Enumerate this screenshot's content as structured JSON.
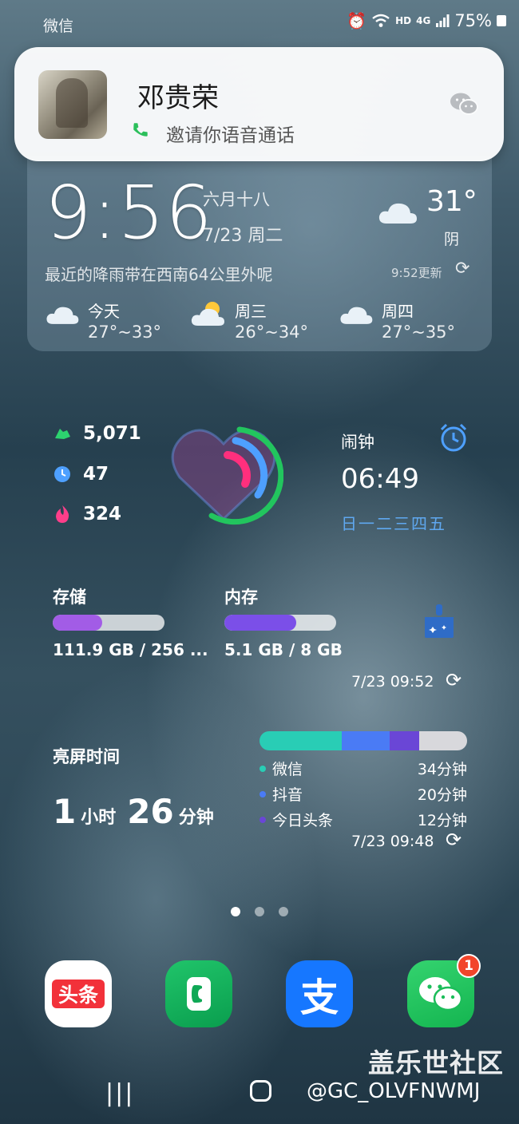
{
  "status_bar": {
    "app_name": "微信",
    "network": "HD",
    "network_gen": "4G",
    "battery": "75%"
  },
  "notification": {
    "caller": "邓贵荣",
    "message": "邀请你语音通话",
    "app_icon": "wechat-icon"
  },
  "clock_widget": {
    "time": "9:56",
    "lunar_date": "六月十八",
    "date": "7/23 周二",
    "current_temp": "31°",
    "condition": "阴",
    "rain_message": "最近的降雨带在西南64公里外呢",
    "updated": "9:52更新",
    "forecast": [
      {
        "day": "今天",
        "range": "27°~33°",
        "icon": "cloud-icon"
      },
      {
        "day": "周三",
        "range": "26°~34°",
        "icon": "partly-sunny-icon"
      },
      {
        "day": "周四",
        "range": "27°~35°",
        "icon": "cloud-icon"
      }
    ]
  },
  "health": {
    "steps": "5,071",
    "active_minutes": "47",
    "calories": "324",
    "colors": {
      "steps": "#2dd36f",
      "time": "#4ea0ff",
      "calories": "#ff3e8a"
    }
  },
  "alarm": {
    "title": "闹钟",
    "time": "06:49",
    "days": "日一二三四五"
  },
  "device_care": {
    "storage_label": "存储",
    "storage_value": "111.9 GB / 256 ...",
    "storage_fraction": 0.44,
    "storage_color": "#a25ce6",
    "memory_label": "内存",
    "memory_value": "5.1 GB / 8 GB",
    "memory_fraction": 0.64,
    "memory_color": "#7b4fe8",
    "updated": "7/23 09:52"
  },
  "screen_time": {
    "title": "亮屏时间",
    "hours": "1",
    "hours_unit": "小时",
    "minutes": "26",
    "minutes_unit": "分钟",
    "apps": [
      {
        "name": "微信",
        "duration": "34分钟",
        "color": "#29cdb5",
        "minutes": 34
      },
      {
        "name": "抖音",
        "duration": "20分钟",
        "color": "#4a7bf5",
        "minutes": 20
      },
      {
        "name": "今日头条",
        "duration": "12分钟",
        "color": "#6a46d6",
        "minutes": 12
      }
    ],
    "other_color": "#d8d8dc",
    "updated": "7/23 09:48"
  },
  "dock": {
    "apps": [
      {
        "name": "头条",
        "icon": "toutiao-icon"
      },
      {
        "name": "phone",
        "icon": "phone-icon"
      },
      {
        "name": "支",
        "icon": "alipay-icon"
      },
      {
        "name": "wechat",
        "icon": "wechat-icon",
        "badge": "1"
      }
    ]
  },
  "watermark": {
    "site": "盖乐世社区",
    "handle": "@GC_OLVFNWMJ"
  }
}
